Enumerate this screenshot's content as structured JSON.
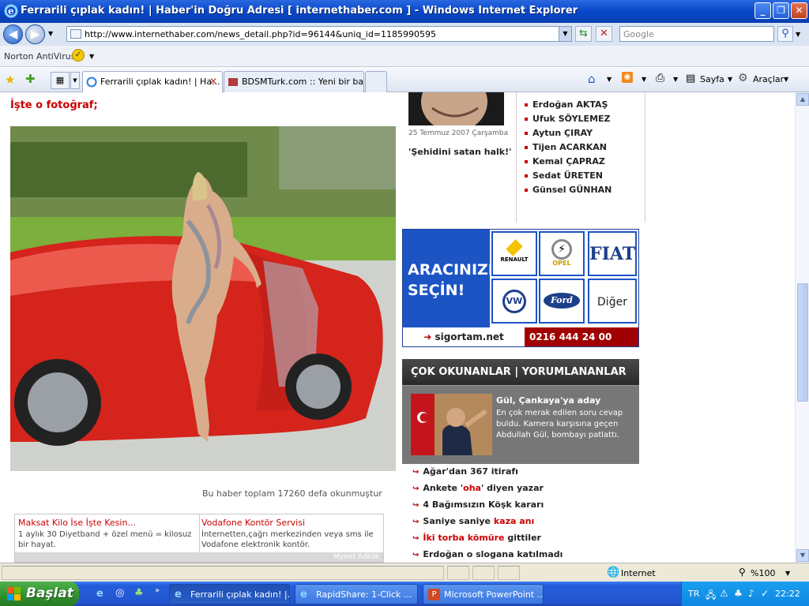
{
  "window": {
    "title": "Ferrarili çıplak kadın! | Haber'in Doğru Adresi [ internethaber.com ] - Windows Internet Explorer",
    "minimize_icon": "minimize-icon",
    "maximize_icon": "restore-icon",
    "close_icon": "close-icon"
  },
  "addressbar": {
    "url": "http://www.internethaber.com/news_detail.php?id=96144&uniq_id=1185990595",
    "search_placeholder": "Google"
  },
  "toolbar": {
    "norton_label": "Norton AntiVirus"
  },
  "tabs": [
    {
      "label": "Ferrarili çıplak kadın! | Ha...",
      "active": true
    },
    {
      "label": "BDSMTurk.com :: Yeni bir baş...",
      "active": false
    }
  ],
  "commands": {
    "page_label": "Sayfa",
    "tools_label": "Araçlar"
  },
  "article": {
    "headline": "İşte o fotoğraf;",
    "read_count": "Bu haber toplam 17260 defa okunmuştur"
  },
  "ads": {
    "left_title": "Maksat Kilo İse İşte Kesin...",
    "left_text": "1 aylık 30 Diyetband + özel menü = kilosuz bir hayat.",
    "right_title": "Vodafone Kontör Servisi",
    "right_text": "İnternetten,çağrı merkezinden veya sms ile Vodafone elektronik kontör.",
    "footer": "Mynet Adklik"
  },
  "columnist": {
    "date": "25 Temmuz 2007 Çarşamba",
    "article": "'Şehidini satan halk!'"
  },
  "authors": [
    "Erdoğan AKTAŞ",
    "Ufuk SÖYLEMEZ",
    "Aytun ÇIRAY",
    "Tijen ACARKAN",
    "Kemal ÇAPRAZ",
    "Sedat ÜRETEN",
    "Günsel GÜNHAN"
  ],
  "banner": {
    "line1": "ARACINIZI",
    "line2": "SEÇİN!",
    "brands": [
      "RENAULT",
      "OPEL",
      "FIAT",
      "VW",
      "Ford",
      "Diğer"
    ],
    "site": "sigortam.net",
    "phone": "0216 444 24 00"
  },
  "mostread": {
    "header": "ÇOK OKUNANLAR | YORUMLANANLAR",
    "feature_title": "Gül, Çankaya'ya aday",
    "feature_desc": "En çok merak edilen soru cevap buldu. Kamera karşısına geçen Abdullah Gül, bombayı patlattı."
  },
  "newslist": [
    {
      "pre": "Ağar'dan 367 itirafı",
      "hl": "",
      "post": ""
    },
    {
      "pre": "Ankete '",
      "hl": "oha",
      "post": "' diyen yazar"
    },
    {
      "pre": "4 Bağımsızın Köşk kararı",
      "hl": "",
      "post": ""
    },
    {
      "pre": "Saniye saniye ",
      "hl": "kaza anı",
      "post": ""
    },
    {
      "pre": "",
      "hl": "İki torba kömüre",
      "post": " gittiler"
    },
    {
      "pre": "Erdoğan o slogana katılmadı",
      "hl": "",
      "post": ""
    }
  ],
  "statusbar": {
    "zone": "Internet",
    "zoom": "%100"
  },
  "taskbar": {
    "start": "Başlat",
    "tasks": [
      "Ferrarili çıplak kadın! |...",
      "RapidShare: 1-Click ...",
      "Microsoft PowerPoint ..."
    ],
    "lang": "TR",
    "clock": "22:22"
  },
  "colors": {
    "accent_red": "#cc0000",
    "xp_blue": "#245edb",
    "banner_blue": "#1d54c4"
  }
}
